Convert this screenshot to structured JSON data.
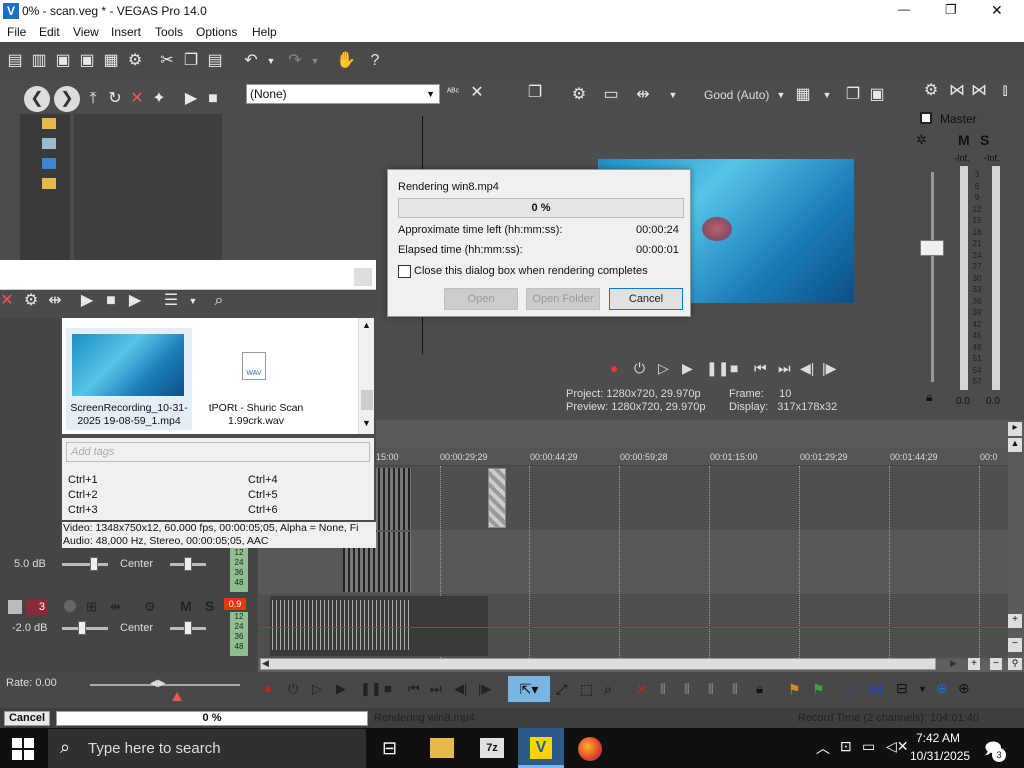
{
  "window": {
    "title": "0% - scan.veg * - VEGAS Pro 14.0",
    "min": "—",
    "max": "❐",
    "close": "✕"
  },
  "menu": [
    "File",
    "Edit",
    "View",
    "Insert",
    "Tools",
    "Options",
    "Help"
  ],
  "preview": {
    "fx_dropdown": "(None)",
    "quality": "Good (Auto)",
    "project_label": "Project:",
    "project_value": "1280x720, 29.970p",
    "preview_label": "Preview:",
    "preview_value": "1280x720, 29.970p",
    "frame_label": "Frame:",
    "frame_value": "10",
    "display_label": "Display:",
    "display_value": "317x178x32"
  },
  "mixer": {
    "label": "Master",
    "m": "M",
    "s": "S",
    "inf_left": "-Inf.",
    "inf_right": "-Inf.",
    "scale": [
      "3",
      "6",
      "9",
      "12",
      "15",
      "18",
      "21",
      "24",
      "27",
      "30",
      "33",
      "36",
      "39",
      "42",
      "45",
      "48",
      "51",
      "54",
      "57"
    ],
    "val_left": "0.0",
    "val_right": "0.0"
  },
  "dialog": {
    "title": "Rendering win8.mp4",
    "percent": "0 %",
    "time_left_label": "Approximate time left (hh:mm:ss):",
    "time_left": "00:00:24",
    "elapsed_label": "Elapsed time (hh:mm:ss):",
    "elapsed": "00:00:01",
    "checkbox_label": "Close this dialog box when rendering completes",
    "open": "Open",
    "open_folder": "Open Folder",
    "cancel": "Cancel"
  },
  "media": {
    "item1": "ScreenRecording_10-31-2025 19-08-59_1.mp4",
    "item2": "tPORt - Shuric Scan 1.99crk.wav",
    "wav_badge": "WAV",
    "tags_placeholder": "Add tags",
    "shortcuts": [
      "Ctrl+1",
      "Ctrl+2",
      "Ctrl+3",
      "Ctrl+4",
      "Ctrl+5",
      "Ctrl+6"
    ],
    "info_video": "Video: 1348x750x12, 60.000 fps, 00:00:05;05, Alpha = None, Fi",
    "info_audio": "Audio: 48,000 Hz, Stereo, 00:00:05;05, AAC"
  },
  "ruler": [
    "15:00",
    "00:00:29;29",
    "00:00:44;29",
    "00:00:59;28",
    "00:01:15:00",
    "00:01:29;29",
    "00:01:44;29",
    "00:0"
  ],
  "tracks": [
    {
      "vol": "5.0 dB",
      "pan": "Center",
      "meter": [
        "12",
        "24",
        "36",
        "48"
      ]
    },
    {
      "num": "3",
      "vol": "-2.0 dB",
      "pan": "Center",
      "meter": [
        "12",
        "24",
        "36",
        "48"
      ],
      "badge": "0.9"
    }
  ],
  "transport": {
    "rate": "Rate: 0.00"
  },
  "status": {
    "cancel": "Cancel",
    "percent": "0 %",
    "text": "Rendering win8.mp4",
    "record": "Record Time (2 channels): 104:01:40"
  },
  "taskbar": {
    "search": "Type here to search",
    "time": "7:42 AM",
    "date": "10/31/2025",
    "notif": "3"
  }
}
